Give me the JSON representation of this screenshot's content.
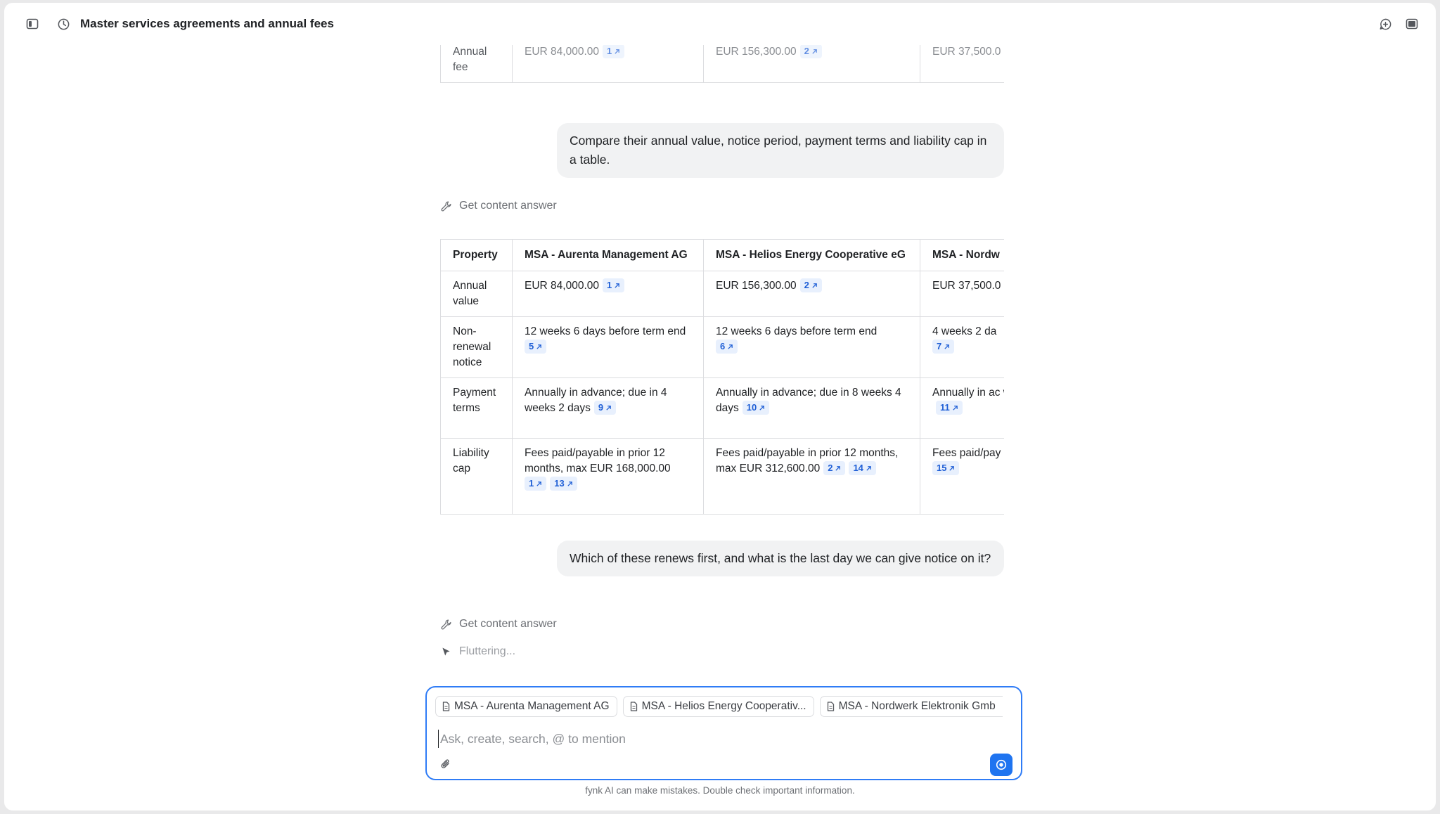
{
  "header": {
    "title": "Master services agreements and annual fees",
    "icons": [
      "sidebar-toggle-icon",
      "history-icon",
      "new-chat-icon",
      "panel-icon"
    ]
  },
  "previous_table": {
    "row": {
      "label": "Annual fee",
      "cells": [
        {
          "text": "EUR 84,000.00",
          "cite": "1"
        },
        {
          "text": "EUR 156,300.00",
          "cite": "2"
        },
        {
          "text": "EUR 37,500.0"
        }
      ]
    }
  },
  "messages": [
    {
      "role": "user",
      "text": "Compare their annual value, notice period, payment terms and liability cap in a table."
    },
    {
      "role": "tool",
      "text": "Get content answer"
    },
    {
      "role": "user",
      "text": "Which of these renews first, and what is the last day we can give notice on it?"
    },
    {
      "role": "tool",
      "text": "Get content answer"
    },
    {
      "role": "status",
      "text": "Fluttering..."
    }
  ],
  "comparison_table": {
    "headers": [
      "Property",
      "MSA - Aurenta Management AG",
      "MSA - Helios Energy Cooperative eG",
      "MSA - Nordw"
    ],
    "rows": [
      {
        "label": "Annual value",
        "cells": [
          {
            "text": "EUR 84,000.00",
            "cites": [
              "1"
            ]
          },
          {
            "text": "EUR 156,300.00",
            "cites": [
              "2"
            ]
          },
          {
            "text": "EUR 37,500.0",
            "cites": []
          }
        ]
      },
      {
        "label": "Non-renewal notice",
        "cells": [
          {
            "text": "12 weeks 6 days before term end",
            "cites": [
              "5"
            ]
          },
          {
            "text": "12 weeks 6 days before term end",
            "cites": [
              "6"
            ]
          },
          {
            "text": "4 weeks 2 da",
            "cites": [
              "7"
            ]
          }
        ]
      },
      {
        "label": "Payment terms",
        "cells": [
          {
            "text": "Annually in advance; due in 4 weeks 2 days",
            "cites": [
              "9"
            ]
          },
          {
            "text": "Annually in advance; due in 8 weeks 4 days",
            "cites": [
              "10"
            ]
          },
          {
            "text": "Annually in ac weeks",
            "cites": [
              "11"
            ]
          }
        ]
      },
      {
        "label": "Liability cap",
        "cells": [
          {
            "text": "Fees paid/payable in prior 12 months, max EUR 168,000.00",
            "cites": [
              "1",
              "13"
            ]
          },
          {
            "text": "Fees paid/payable in prior 12 months, max EUR 312,600.00",
            "cites": [
              "2",
              "14"
            ]
          },
          {
            "text": "Fees paid/pay months, max",
            "cites": [
              "15"
            ]
          }
        ]
      }
    ]
  },
  "composer": {
    "chips": [
      "MSA - Aurenta Management AG",
      "MSA - Helios Energy Cooperativ...",
      "MSA - Nordwerk Elektronik Gmb"
    ],
    "placeholder": "Ask, create, search, @ to mention"
  },
  "footer": {
    "disclaimer": "fynk AI can make mistakes. Double check important information."
  },
  "colors": {
    "accent": "#1f74f0",
    "cite_bg": "#e8f0fd",
    "cite_text": "#1f5fd6",
    "bubble_bg": "#f1f2f3"
  }
}
